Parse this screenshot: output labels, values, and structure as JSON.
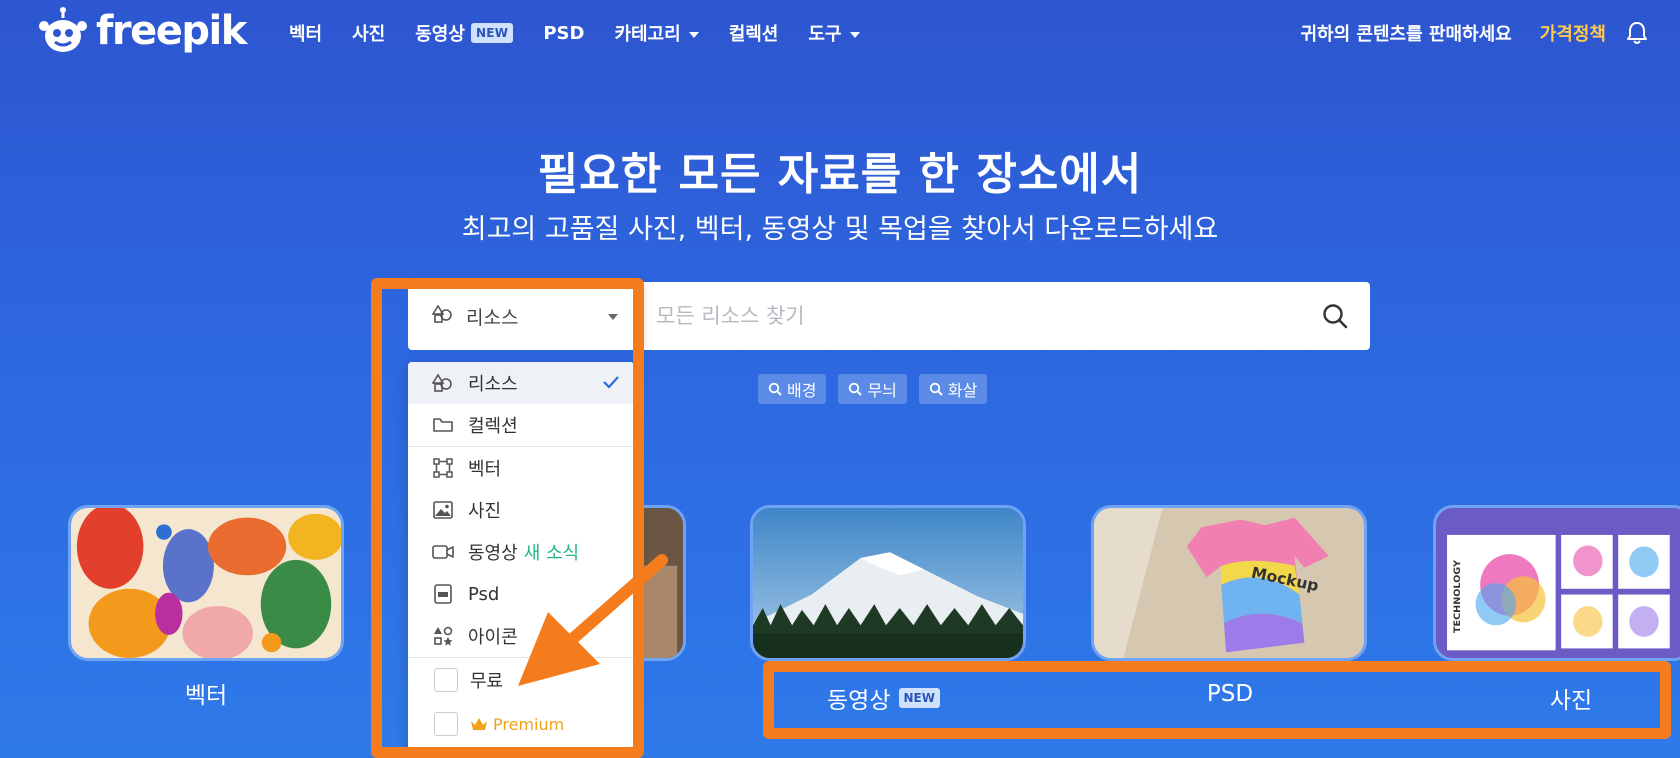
{
  "header": {
    "logo_text": "freepik",
    "nav": [
      {
        "label": "벡터"
      },
      {
        "label": "사진"
      },
      {
        "label": "동영상",
        "badge": "NEW"
      },
      {
        "label": "PSD"
      },
      {
        "label": "카테고리",
        "dropdown": true
      },
      {
        "label": "컬렉션"
      },
      {
        "label": "도구",
        "dropdown": true
      }
    ],
    "sell_link": "귀하의 콘텐츠를 판매하세요",
    "pricing_link": "가격정책",
    "pricing_color": "#ffc94d",
    "bell_icon": "bell-icon"
  },
  "hero": {
    "title": "필요한 모든 자료를 한 장소에서",
    "subtitle": "최고의 고품질 사진, 벡터, 동영상 및 목업을 찾아서 다운로드하세요"
  },
  "search": {
    "resource_selected": "리소스",
    "placeholder": "모든 리소스 찾기",
    "tags": [
      "배경",
      "무늬",
      "화살"
    ]
  },
  "dropdown": {
    "items_top": [
      {
        "label": "리소스",
        "icon": "resources-icon",
        "selected": true
      },
      {
        "label": "컬렉션",
        "icon": "folder-icon",
        "selected": false
      }
    ],
    "items_types": [
      {
        "label": "벡터",
        "icon": "vector-icon"
      },
      {
        "label": "사진",
        "icon": "photo-icon"
      },
      {
        "label": "동영상",
        "icon": "video-icon",
        "extra": "새 소식"
      },
      {
        "label": "Psd",
        "icon": "psd-icon"
      },
      {
        "label": "아이콘",
        "icon": "icons-icon"
      }
    ],
    "license": [
      {
        "label": "무료",
        "checked": false
      },
      {
        "label": "Premium",
        "checked": false
      }
    ]
  },
  "cards": [
    {
      "label": "벡터"
    },
    {
      "label": "동영상",
      "badge": "NEW"
    },
    {
      "label": "PSD"
    },
    {
      "label": "사진"
    }
  ],
  "colors": {
    "accent_orange": "#f47c1d",
    "brand_blue": "#2d56cf",
    "new_green": "#1fb784",
    "premium_gold": "#f0a11a"
  }
}
